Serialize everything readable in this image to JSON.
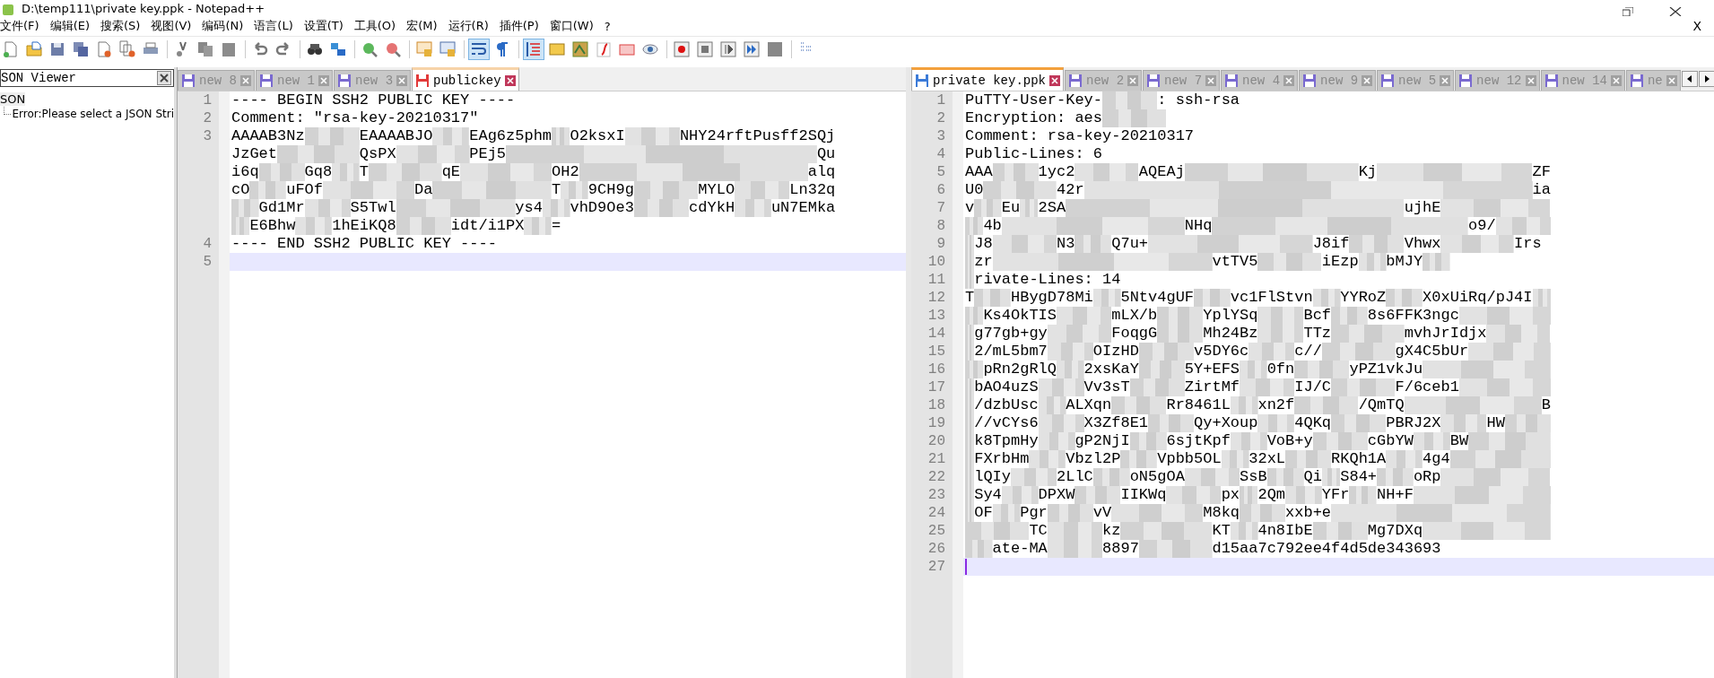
{
  "window": {
    "title": "D:\\temp111\\private key.ppk - Notepad++"
  },
  "menu": [
    "文件(F)",
    "编辑(E)",
    "搜索(S)",
    "视图(V)",
    "编码(N)",
    "语言(L)",
    "设置(T)",
    "工具(O)",
    "宏(M)",
    "运行(R)",
    "插件(P)",
    "窗口(W)",
    "?"
  ],
  "close_document": "X",
  "toolbar": {
    "word_wrap": true,
    "indent_guide": true
  },
  "json_viewer": {
    "title": "SON Viewer",
    "root": "SON",
    "children": [
      {
        "label": "Error:Please select a JSON Stri"
      }
    ]
  },
  "views": [
    {
      "focused": false,
      "tabs": [
        {
          "label": "new 8",
          "selected": false,
          "modified": false
        },
        {
          "label": "new 1",
          "selected": false,
          "modified": false
        },
        {
          "label": "new 3",
          "selected": false,
          "modified": false
        },
        {
          "label": "publickey",
          "selected": true,
          "modified": true
        }
      ],
      "lines": [
        {
          "number": "1",
          "current": false,
          "rows": [
            "---- BEGIN SSH2 PUBLIC KEY ----"
          ]
        },
        {
          "number": "2",
          "current": false,
          "rows": [
            "Comment: \"rsa-key-20210317\""
          ]
        },
        {
          "number": "3",
          "current": false,
          "rows": [
            "AAAAB3Nz      EAAAABJO    EAg6z5phm  O2ksxI      NHY24rftPusff2SQj",
            "JzGet         QsPX        PEj5                                  Qu",
            "i6q     Gq8   T        qE          OH2                         alq",
            "cO    uFOf          Da             T   9CH9g       MYLO      Ln32q",
            "   Gd1Mr     S5Twl             ys4   vhD9Oe3      cdYkH    uN7EMka",
            "  E6Bhw    1hEiKQ8      idt/i1PX   ="
          ]
        },
        {
          "number": "4",
          "current": false,
          "rows": [
            "---- END SSH2 PUBLIC KEY ----"
          ]
        },
        {
          "number": "5",
          "current": true
        }
      ]
    },
    {
      "focused": true,
      "tabs": [
        {
          "label": "private key.ppk",
          "selected": true,
          "modified": false
        },
        {
          "label": "new 2",
          "selected": false,
          "modified": false
        },
        {
          "label": "new 7",
          "selected": false,
          "modified": false
        },
        {
          "label": "new 4",
          "selected": false,
          "modified": false
        },
        {
          "label": "new 9",
          "selected": false,
          "modified": false
        },
        {
          "label": "new 5",
          "selected": false,
          "modified": false
        },
        {
          "label": "new 12",
          "selected": false,
          "modified": false
        },
        {
          "label": "new 14",
          "selected": false,
          "modified": false
        },
        {
          "label": "ne",
          "selected": false,
          "modified": false
        }
      ],
      "lines": [
        {
          "number": "1",
          "current": false,
          "rows": [
            "PuTTY-User-Key-      : ssh-rsa"
          ]
        },
        {
          "number": "2",
          "current": false,
          "rows": [
            "Encryption: aes       "
          ]
        },
        {
          "number": "3",
          "current": false,
          "rows": [
            "Comment: rsa-key-20210317"
          ]
        },
        {
          "number": "4",
          "current": false,
          "rows": [
            "Public-Lines: 6"
          ]
        },
        {
          "number": "5",
          "current": false,
          "rows": [
            "AAA     1yc2       AQEAj                   Kj                 ZF"
          ]
        },
        {
          "number": "6",
          "current": false,
          "rows": [
            "U0        42r                                                 ia"
          ]
        },
        {
          "number": "7",
          "current": false,
          "rows": [
            "v   Eu  2SA                                     ujhE            "
          ]
        },
        {
          "number": "8",
          "current": false,
          "rows": [
            "  4b                    NHq                            o9/      "
          ]
        },
        {
          "number": "9",
          "current": false,
          "rows": [
            " J8       N3    Q7u+                  J8if      Vhwx        Irs"
          ]
        },
        {
          "number": "10",
          "current": false,
          "rows": [
            " zr                        vtTV5       iEzp   bMJY   "
          ]
        },
        {
          "number": "11",
          "current": false,
          "rows": [
            " rivate-Lines: 14"
          ]
        },
        {
          "number": "12",
          "current": false,
          "rows": [
            "T    HBygD78Mi   5Ntv4gUF    vc1FlStvn   YYRoZ    X0xUiRq/pJ4I  "
          ]
        },
        {
          "number": "13",
          "current": false,
          "rows": [
            "  Ks4OkTIS      mLX/b     YplYSq     Bcf    8s6FFK3ngc          "
          ]
        },
        {
          "number": "14",
          "current": false,
          "rows": [
            " g77gb+gy       FoqgG     Mh24Bz     TTz        mvhJrIdjx       "
          ]
        },
        {
          "number": "15",
          "current": false,
          "rows": [
            " 2/mL5bm7     OIzHD      v5DY6c     c//        gX4C5bUr         "
          ]
        },
        {
          "number": "16",
          "current": false,
          "rows": [
            "  pRn2gRlQ   2xsKaY     5Y+EFS   0fn      yPZ1vkJu              "
          ]
        },
        {
          "number": "17",
          "current": false,
          "rows": [
            " bAO4uzS     Vv3sT      ZirtMf      IJ/C       F/6ceb1          "
          ]
        },
        {
          "number": "18",
          "current": false,
          "rows": [
            " /dzbUsc   ALXqn      Rr8461L   xn2f       /QmTQ               B"
          ]
        },
        {
          "number": "19",
          "current": false,
          "rows": [
            " //vCYs6     X3Zf8E1     Qy+Xoup    4QKq      PBRJ2X     HW     "
          ]
        },
        {
          "number": "20",
          "current": false,
          "rows": [
            " k8TpmHy    gP2NjI    6sjtKpf    VoB+y      cGbYW    BW         "
          ]
        },
        {
          "number": "21",
          "current": false,
          "rows": [
            " FXrbHm    Vbzl2P    Vpbb5OL   32xL     RKQh1A    4g4           "
          ]
        },
        {
          "number": "22",
          "current": false,
          "rows": [
            " lQIy     2LlC    oN5gOA      SsB    Qi  S84+    oRp            "
          ]
        },
        {
          "number": "23",
          "current": false,
          "rows": [
            " Sy4    DPXW     IIKWq      px  2Qm    YFr   NH+F               "
          ]
        },
        {
          "number": "24",
          "current": false,
          "rows": [
            " OF   Pgr     vV          M8kq     xxb+e                        "
          ]
        },
        {
          "number": "25",
          "current": false,
          "rows": [
            "       TC      kz          KT   4n8IbE      Mg7DXq              "
          ]
        },
        {
          "number": "26",
          "current": false,
          "rows": [
            "   ate-MA      8897        d15aa7c792ee4f4d5de343693"
          ]
        },
        {
          "number": "27",
          "current": true
        }
      ]
    }
  ]
}
